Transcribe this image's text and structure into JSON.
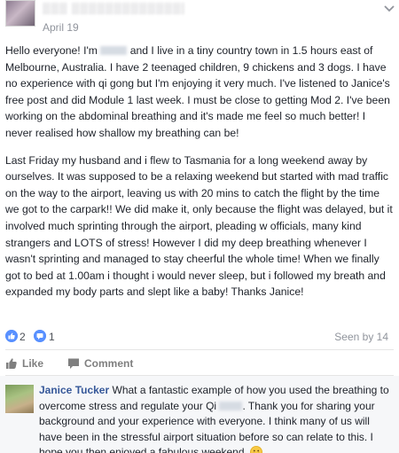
{
  "post": {
    "date": "April 19",
    "paragraph1_a": "Hello everyone! I'm ",
    "paragraph1_b": " and I live in a tiny country town in 1.5 hours east of Melbourne, Australia. I have 2 teenaged children, 9 chickens and 3 dogs. I have no experience with qi gong but I'm enjoying it very much. I've listened to Janice's free post and did Module 1 last week. I must be close to getting Mod 2. I've been working on the abdominal breathing and it's made me feel so much better! I never realised how shallow my breathing can be!",
    "paragraph2": "Last Friday my husband and i flew to Tasmania for a long weekend away by ourselves. It was supposed to be a relaxing weekend but started with mad traffic on the way to the airport, leaving us with 20 mins to catch the flight by the time we got to the carpark!! We did make it, only because the flight was delayed, but it involved much sprinting through the airport, pleading w officials, many kind strangers and LOTS of stress! However I did my deep breathing whenever I wasn't sprinting and managed to stay cheerful the whole time! When we finally got to bed at 1.00am i thought i would never sleep, but i followed my breath and expanded my body parts and slept like a baby! Thanks Janice!"
  },
  "reactions": {
    "like_count": "2",
    "comment_count": "1",
    "seen_by": "Seen by 14"
  },
  "actions": {
    "like_label": "Like",
    "comment_label": "Comment"
  },
  "comment": {
    "author": "Janice Tucker",
    "text_a": " What a fantastic example of how you used the breathing to overcome stress and regulate your Qi ",
    "text_b": ". Thank you for sharing your background and your experience with everyone. I think many of us will have been in the stressful airport situation before so can relate to this. I hope you then enjoyed a fabulous weekend. "
  },
  "colors": {
    "link_blue": "#365899",
    "like_blue": "#5890ff",
    "muted_gray": "#90949c"
  },
  "icons": [
    "chevron-down-icon",
    "like-reaction-icon",
    "comment-count-icon",
    "thumbs-up-icon",
    "comment-bubble-icon",
    "smiley-emoji-icon"
  ]
}
